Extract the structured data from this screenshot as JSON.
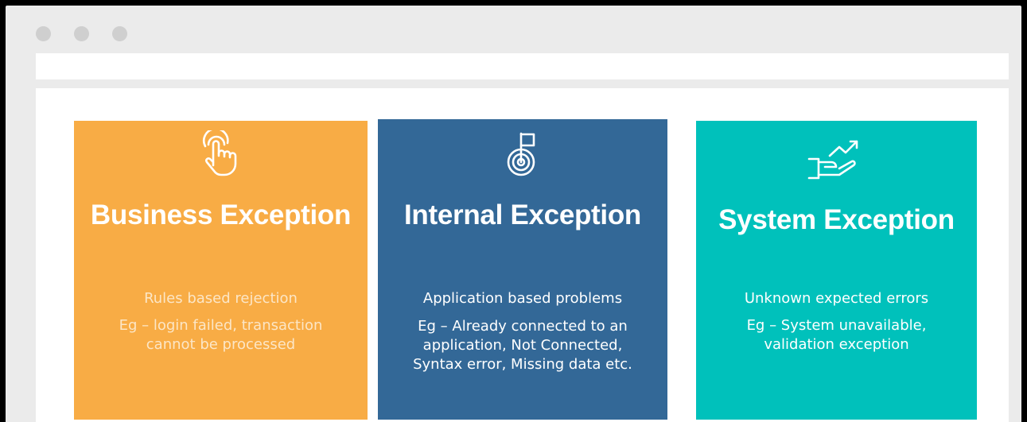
{
  "window": {
    "colors": {
      "frame": "#ebebeb",
      "dots": "#cfcfcf",
      "content": "#ffffff"
    }
  },
  "cards": [
    {
      "id": "business",
      "icon": "tap-hand-icon",
      "title": "Business Exception",
      "subtitle": "Rules based rejection",
      "description": "Eg – login failed, transaction cannot be processed",
      "color": "#f8ac45"
    },
    {
      "id": "internal",
      "icon": "target-flag-icon",
      "title": "Internal Exception",
      "subtitle": "Application based problems",
      "description": "Eg – Already connected to an application, Not Connected, Syntax error, Missing data etc.",
      "color": "#336897"
    },
    {
      "id": "system",
      "icon": "hand-growth-chart-icon",
      "title": "System Exception",
      "subtitle": "Unknown expected errors",
      "description": "Eg – System unavailable, validation exception",
      "color": "#00c1bb"
    }
  ]
}
